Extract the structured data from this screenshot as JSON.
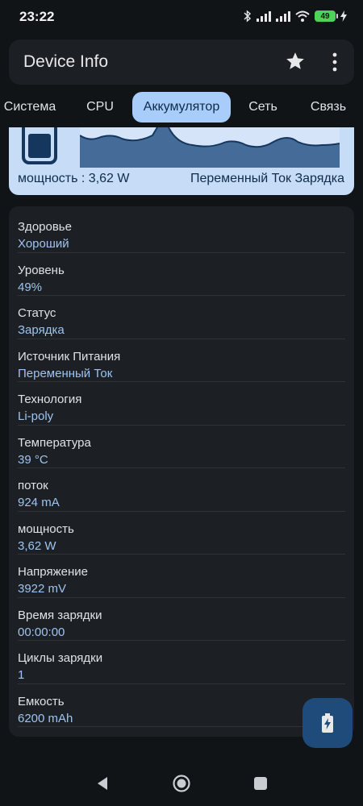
{
  "status_bar": {
    "time": "23:22",
    "battery_level": "49",
    "icons": [
      "bluetooth-icon",
      "signal-icon",
      "signal-icon",
      "wifi-icon",
      "battery-icon",
      "charging-icon"
    ]
  },
  "app_bar": {
    "title": "Device Info",
    "actions": [
      "star-icon",
      "more-vert-icon"
    ]
  },
  "tabs": [
    {
      "label": "Система",
      "active": false
    },
    {
      "label": "CPU",
      "active": false
    },
    {
      "label": "Аккумулятор",
      "active": true
    },
    {
      "label": "Сеть",
      "active": false
    },
    {
      "label": "Связь",
      "active": false
    }
  ],
  "graph_card": {
    "power_text": "мощность : 3,62 W",
    "source_text": "Переменный Ток Зарядка"
  },
  "info_list": [
    {
      "label": "Здоровье",
      "value": "Хороший"
    },
    {
      "label": "Уровень",
      "value": "49%"
    },
    {
      "label": "Статус",
      "value": "Зарядка"
    },
    {
      "label": "Источник Питания",
      "value": "Переменный Ток"
    },
    {
      "label": "Технология",
      "value": "Li-poly"
    },
    {
      "label": "Температура",
      "value": "39 °C"
    },
    {
      "label": "поток",
      "value": "924 mA"
    },
    {
      "label": "мощность",
      "value": "3,62 W"
    },
    {
      "label": "Напряжение",
      "value": "3922 mV"
    },
    {
      "label": "Время зарядки",
      "value": "00:00:00"
    },
    {
      "label": "Циклы зарядки",
      "value": "1"
    },
    {
      "label": "Емкость",
      "value": "6200 mAh"
    }
  ],
  "fab": {
    "icon": "battery-charging-icon"
  },
  "nav_bar": {
    "icons": [
      "back-icon",
      "home-icon",
      "recents-icon"
    ]
  },
  "colors": {
    "background": "#101417",
    "surface": "#1c2024",
    "accent": "#a9cdfa",
    "value_text": "#9fc3ef",
    "fab": "#1f4b7a"
  }
}
